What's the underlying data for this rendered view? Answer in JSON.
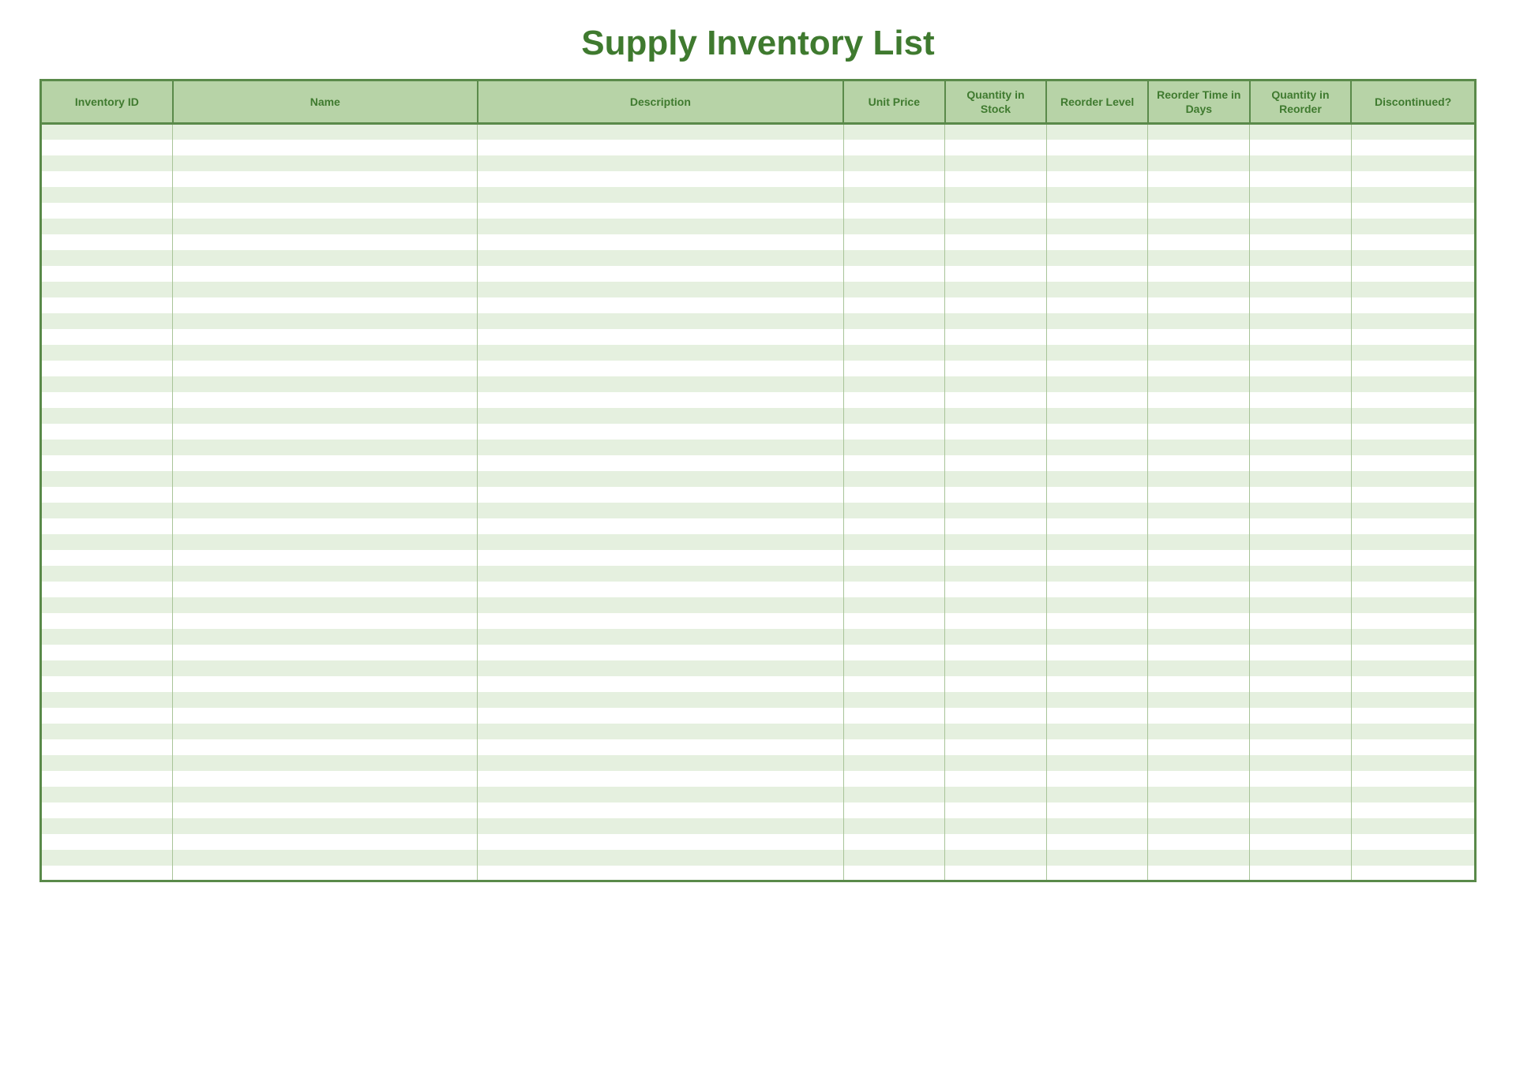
{
  "title": "Supply Inventory List",
  "columns": [
    {
      "label": "Inventory ID"
    },
    {
      "label": "Name"
    },
    {
      "label": "Description"
    },
    {
      "label": "Unit Price"
    },
    {
      "label": "Quantity in Stock"
    },
    {
      "label": "Reorder Level"
    },
    {
      "label": "Reorder Time in Days"
    },
    {
      "label": "Quantity in Reorder"
    },
    {
      "label": "Discontinued?"
    }
  ],
  "row_count": 48,
  "rows": []
}
